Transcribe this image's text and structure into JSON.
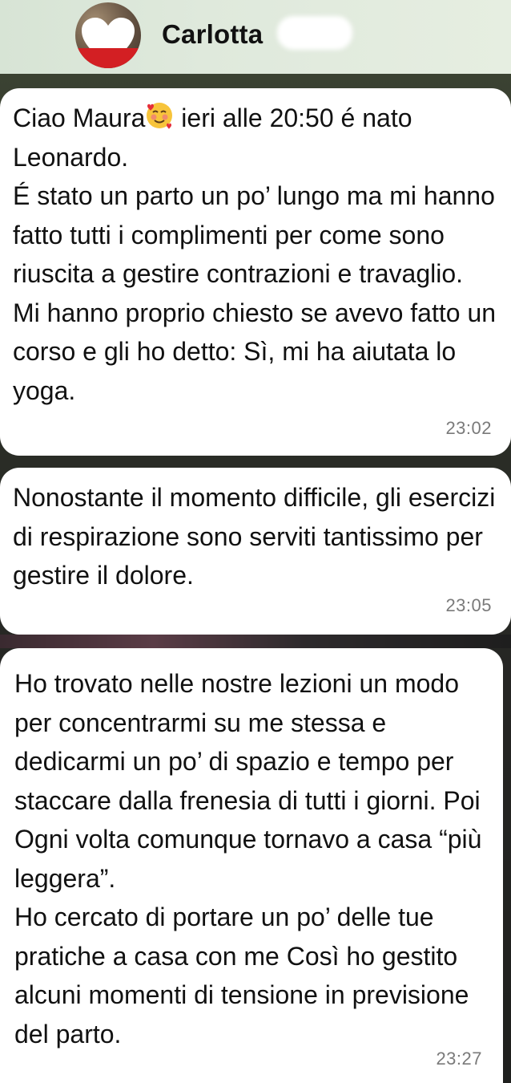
{
  "header": {
    "contact_name": "Carlotta"
  },
  "messages": [
    {
      "text_before_emoji": "Ciao Maura",
      "emoji": "smiling-face-with-hearts-icon",
      "text_after_emoji": " ieri alle 20:50 é nato\nLeonardo.\nÉ stato un parto un po’ lungo ma mi hanno fatto tutti i complimenti per come sono riuscita a gestire contrazioni e travaglio.\nMi hanno proprio chiesto se avevo fatto un corso e gli ho detto: Sì, mi ha aiutata lo yoga.",
      "time": "23:02"
    },
    {
      "text": "Nonostante il momento difficile, gli esercizi di respirazione sono serviti tantissimo per gestire il dolore.",
      "time": "23:05"
    },
    {
      "text": "Ho trovato nelle nostre lezioni un modo per concentrarmi su me stessa e dedicarmi un po’ di spazio e tempo per staccare dalla frenesia di tutti i giorni. Poi Ogni volta comunque tornavo a casa “più leggera”.\nHo cercato di portare un po’ delle tue pratiche a casa con me Così ho gestito alcuni momenti di tensione in previsione del parto.",
      "time": "23:27"
    }
  ]
}
